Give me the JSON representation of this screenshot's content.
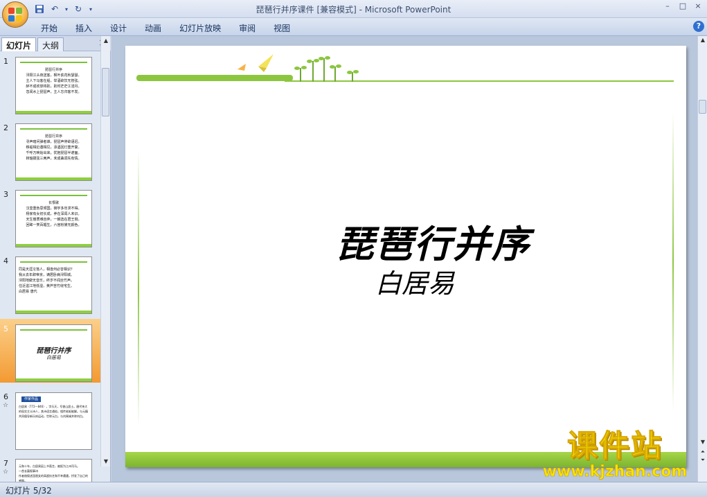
{
  "window": {
    "title": "琵琶行并序课件 [兼容模式] - Microsoft PowerPoint",
    "controls": [
      "–",
      "□",
      "×"
    ]
  },
  "ribbon": {
    "tabs": [
      "开始",
      "插入",
      "设计",
      "动画",
      "幻灯片放映",
      "审阅",
      "视图"
    ],
    "help": "?"
  },
  "panel": {
    "tabs": [
      "幻灯片",
      "大纲"
    ],
    "close": "×"
  },
  "thumbnails": [
    {
      "num": "1",
      "text": "琵琶行并序\n浔阳江头夜送客，枫叶荻花秋瑟瑟。\n主人下马客在船，举酒欲饮无管弦。\n醉不成欢惨将别，别时茫茫江浸月。\n忽闻水上琵琶声，主人忘归客不发。"
    },
    {
      "num": "2",
      "text": "琵琶行并序\n寻声暗问弹者谁，琵琶声停欲语迟。\n移船相近邀相见，添酒回灯重开宴。\n千呼万唤始出来，犹抱琵琶半遮面。\n转轴拨弦三两声，未成曲调先有情。"
    },
    {
      "num": "3",
      "text": "长恨歌\n汉皇重色思倾国，御宇多年求不得。\n杨家有女初长成，养在深闺人未识。\n天生丽质难自弃，一朝选在君王侧。\n回眸一笑百媚生，六宫粉黛无颜色。"
    },
    {
      "num": "4",
      "text": "同是天涯沦落人，相逢何必曾相识？\n我从去年辞帝京，谪居卧病浔阳城。\n浔阳地僻无音乐，终岁不闻丝竹声。\n住近湓江地低湿，黄芦苦竹绕宅生。\n白居易  唐代"
    },
    {
      "num": "5",
      "title": "琵琶行并序",
      "subtitle": "白居易",
      "selected": true
    },
    {
      "num": "6",
      "header": "作家作品",
      "text": "白居易（772—846），字乐天，号香山居士。唐代伟大的现实主义诗人，其诗语言通俗，相传老妪能解。与元稹共同倡导新乐府运动，世称元白，与刘禹锡并称刘白。"
    },
    {
      "num": "7",
      "text": "元和十年，白居易因上书直言，被贬为江州司马。\n一首长篇叙事诗\n作者借叙述琵琶女的高超技艺和不幸遭遇，抒发了自己的感慨。"
    }
  ],
  "slide": {
    "title": "琵琶行并序",
    "subtitle": "白居易"
  },
  "status": {
    "text": "幻灯片 5/32"
  },
  "watermark": {
    "line1": "课件站",
    "line2": "www.kjzhan.com"
  },
  "colors": {
    "accent_green": "#8cc63f",
    "selected_orange": "#f39a32"
  }
}
